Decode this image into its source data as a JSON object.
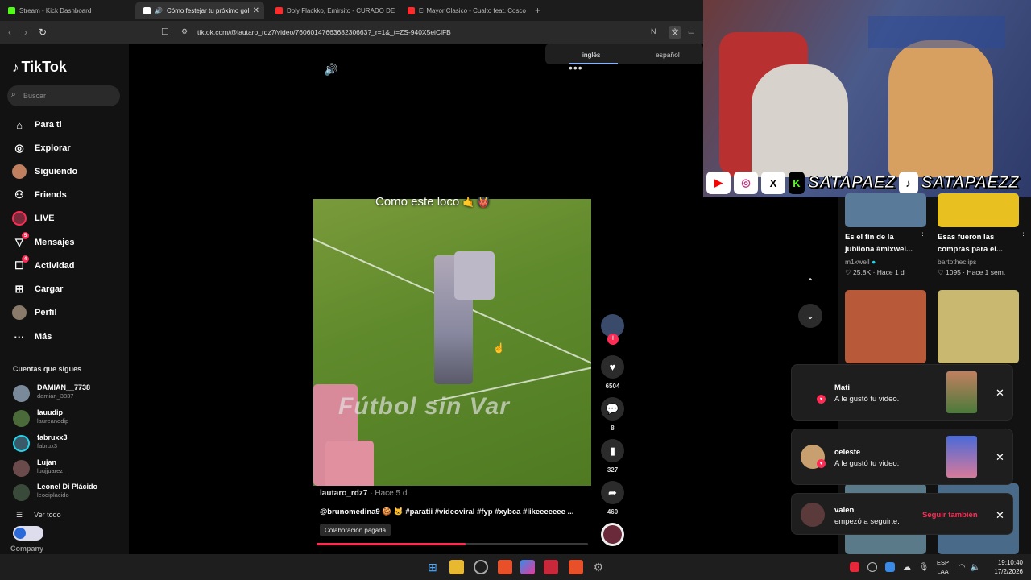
{
  "browser": {
    "tabs": [
      {
        "title": "Stream - Kick Dashboard",
        "color": "#53fc18"
      },
      {
        "title": "Cómo festejar tu próximo gol",
        "color": "#ffffff"
      },
      {
        "title": "Doly Flackko, Emirsito - CURADO DE",
        "color": "#ff2a2a"
      },
      {
        "title": "El Mayor Clasico - Cualto feat. Cosco",
        "color": "#ff2a2a"
      }
    ],
    "new_tab": "+",
    "url": "tiktok.com/@lautaro_rdz7/video/7606014766368230663?_r=1&_t=ZS-940X5eiClFB",
    "translate": {
      "lang1": "inglés",
      "lang2": "español"
    }
  },
  "sidebar": {
    "logo": "TikTok",
    "search_placeholder": "Buscar",
    "nav": [
      {
        "label": "Para ti",
        "icon": "home-icon",
        "glyph": "⌂"
      },
      {
        "label": "Explorar",
        "icon": "compass-icon",
        "glyph": "◎"
      },
      {
        "label": "Siguiendo",
        "icon": "following-icon",
        "glyph": ""
      },
      {
        "label": "Friends",
        "icon": "friends-icon",
        "glyph": "👥"
      },
      {
        "label": "LIVE",
        "icon": "live-icon",
        "glyph": ""
      },
      {
        "label": "Mensajes",
        "icon": "messages-icon",
        "glyph": "▽",
        "badge": "5"
      },
      {
        "label": "Actividad",
        "icon": "activity-icon",
        "glyph": "☐",
        "badge": "4"
      },
      {
        "label": "Cargar",
        "icon": "upload-icon",
        "glyph": "⊞"
      },
      {
        "label": "Perfil",
        "icon": "profile-icon",
        "glyph": ""
      },
      {
        "label": "Más",
        "icon": "more-icon",
        "glyph": "···"
      }
    ],
    "following_title": "Cuentas que sigues",
    "following": [
      {
        "name": "DAMIAN__7738",
        "handle": "damian_3837"
      },
      {
        "name": "lauudip",
        "handle": "laureanodip"
      },
      {
        "name": "fabruxx3",
        "handle": "fabrux3"
      },
      {
        "name": "Lujan",
        "handle": "luujjuarez_"
      },
      {
        "name": "Leonel Di Plácido",
        "handle": "leodiplacido"
      }
    ],
    "see_all": "Ver todo",
    "company": "Company"
  },
  "video": {
    "caption_top": "Como este loco",
    "watermark": "Fútbol sin Var",
    "author": "lautaro_rdz7",
    "time": " · Hace 5 d",
    "description": "@brunomedina9 🍪 🐱 #paratii #videoviral #fyp #xybca #likeeeeeee ...",
    "paid_label": "Colaboración pagada",
    "progress": 0.55,
    "actions": {
      "likes": "6504",
      "comments": "8",
      "saves": "327",
      "shares": "460"
    }
  },
  "stream": {
    "handle1": "SATAPAEZ",
    "handle2": "SATAPAEZZ"
  },
  "recommended": [
    {
      "title": "Es el fin de la jubilona #mixwel...",
      "author": "m1xwell",
      "likes": "25.8K",
      "time": "Hace 1 d"
    },
    {
      "title": "Esas fueron las compras para el...",
      "author": "bartotheclips",
      "likes": "1095",
      "time": "Hace 1 sem."
    }
  ],
  "notifications": [
    {
      "name": "Mati",
      "text": "A le gustó tu video."
    },
    {
      "name": "celeste",
      "text": "A le gustó tu video."
    },
    {
      "name": "valen",
      "text": "empezó a seguirte.",
      "action": "Seguir también"
    }
  ],
  "taskbar": {
    "lang": "ESP",
    "region": "LAA",
    "time": "19:10:40",
    "date": "17/2/2026"
  }
}
